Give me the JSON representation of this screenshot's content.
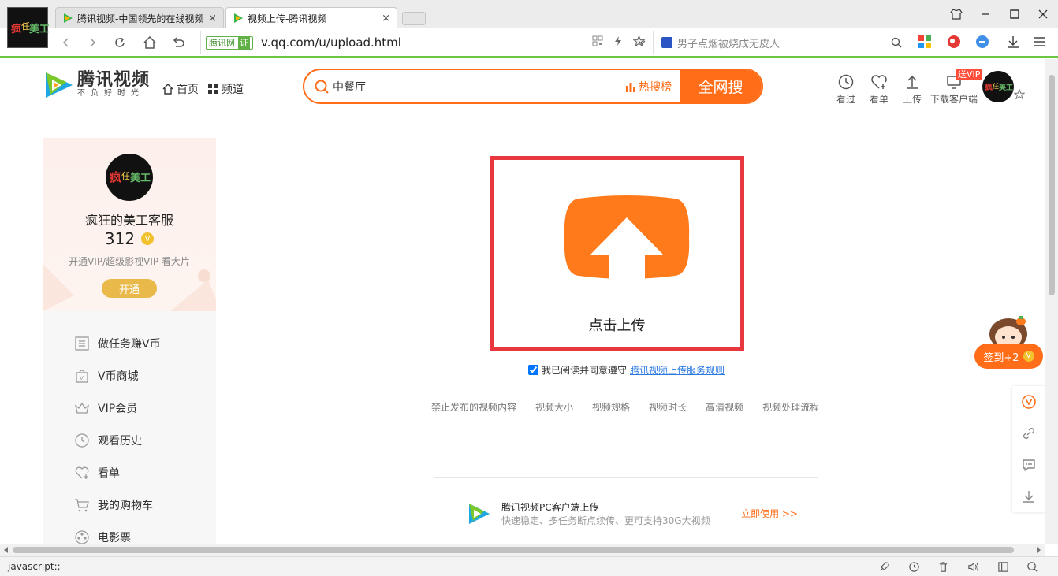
{
  "browser": {
    "tabs": [
      {
        "title": "腾讯视频-中国领先的在线视频",
        "active": false
      },
      {
        "title": "视频上传-腾讯视频",
        "active": true
      }
    ],
    "close_glyph": "×",
    "cert_site": "腾讯网",
    "cert_badge": "证",
    "url": "v.qq.com/u/upload.html",
    "side_search_text": "男子点烟被烧成无皮人",
    "status_text": "javascript:;"
  },
  "header": {
    "brand": "腾讯视频",
    "slogan": "不负好时光",
    "nav_home": "首页",
    "nav_channel": "频道",
    "search_value": "中餐厅",
    "hot_search": "热搜榜",
    "search_button": "全网搜",
    "icons": [
      {
        "label": "看过",
        "icon": "history-icon"
      },
      {
        "label": "看单",
        "icon": "heart-plus-icon"
      },
      {
        "label": "上传",
        "icon": "upload-icon"
      },
      {
        "label": "下载客户端",
        "icon": "monitor-icon"
      }
    ],
    "vip_badge": "送VIP"
  },
  "user": {
    "name": "疯狂的美工客服",
    "vcoins": "312",
    "vip_tip": "开通VIP/超级影视VIP 看大片",
    "open_button": "开通"
  },
  "menu": [
    {
      "label": "做任务赚V币",
      "icon": "task-list-icon"
    },
    {
      "label": "V币商城",
      "icon": "shopping-bag-icon"
    },
    {
      "label": "VIP会员",
      "icon": "vip-crown-icon"
    },
    {
      "label": "观看历史",
      "icon": "clock-icon"
    },
    {
      "label": "看单",
      "icon": "heart-plus-icon"
    },
    {
      "label": "我的购物车",
      "icon": "cart-icon"
    },
    {
      "label": "电影票",
      "icon": "film-reel-icon"
    }
  ],
  "upload": {
    "label": "点击上传",
    "agree_text": "我已阅读并同意遵守",
    "agree_link": "腾讯视频上传服务规则",
    "agree_checked": true,
    "rules": [
      "禁止发布的视频内容",
      "视频大小",
      "视频规格",
      "视频时长",
      "高清视频",
      "视频处理流程"
    ],
    "pc_title": "腾讯视频PC客户端上传",
    "pc_desc": "快速稳定、多任务断点续传、更可支持30G大视频",
    "pc_action": "立即使用 >>"
  },
  "floating": {
    "signin_label": "签到+2",
    "v_mark": "V"
  },
  "colors": {
    "accent": "#ff6d19",
    "upload_border": "#e8373f",
    "vip_gold": "#e9b94a",
    "link": "#2a7ae2"
  }
}
